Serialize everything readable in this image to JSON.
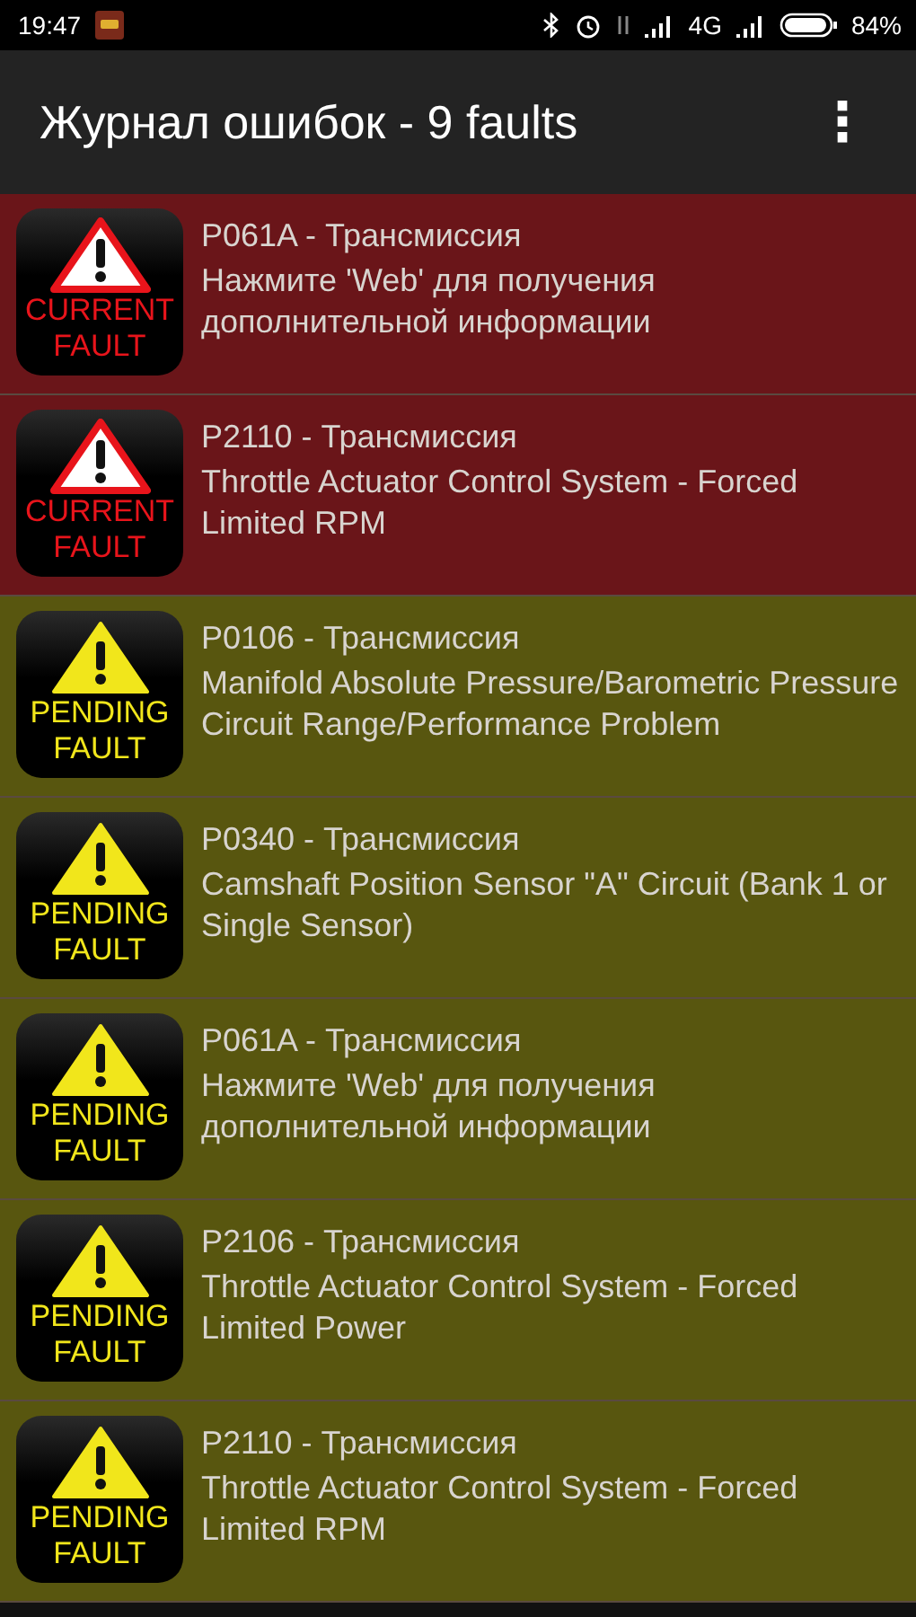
{
  "status_bar": {
    "time": "19:47",
    "network": "4G",
    "battery": "84%"
  },
  "app_bar": {
    "title": "Журнал ошибок - 9 faults",
    "menu": "⋮"
  },
  "faults": [
    {
      "kind": "current",
      "badge": [
        "CURRENT",
        "FAULT"
      ],
      "code": "P061A - Трансмиссия",
      "description": "Нажмите 'Web' для получения дополнительной информации"
    },
    {
      "kind": "current",
      "badge": [
        "CURRENT",
        "FAULT"
      ],
      "code": "P2110 - Трансмиссия",
      "description": "Throttle Actuator Control System - Forced Limited RPM"
    },
    {
      "kind": "pending",
      "badge": [
        "PENDING",
        "FAULT"
      ],
      "code": "P0106 - Трансмиссия",
      "description": "Manifold Absolute Pressure/Barometric Pressure Circuit Range/Performance Problem"
    },
    {
      "kind": "pending",
      "badge": [
        "PENDING",
        "FAULT"
      ],
      "code": "P0340 - Трансмиссия",
      "description": "Camshaft Position Sensor \"A\" Circuit (Bank 1 or Single Sensor)"
    },
    {
      "kind": "pending",
      "badge": [
        "PENDING",
        "FAULT"
      ],
      "code": "P061A - Трансмиссия",
      "description": "Нажмите 'Web' для получения дополнительной информации"
    },
    {
      "kind": "pending",
      "badge": [
        "PENDING",
        "FAULT"
      ],
      "code": "P2106 - Трансмиссия",
      "description": "Throttle Actuator Control System - Forced Limited Power"
    },
    {
      "kind": "pending",
      "badge": [
        "PENDING",
        "FAULT"
      ],
      "code": "P2110 - Трансмиссия",
      "description": "Throttle Actuator Control System - Forced Limited RPM"
    }
  ]
}
